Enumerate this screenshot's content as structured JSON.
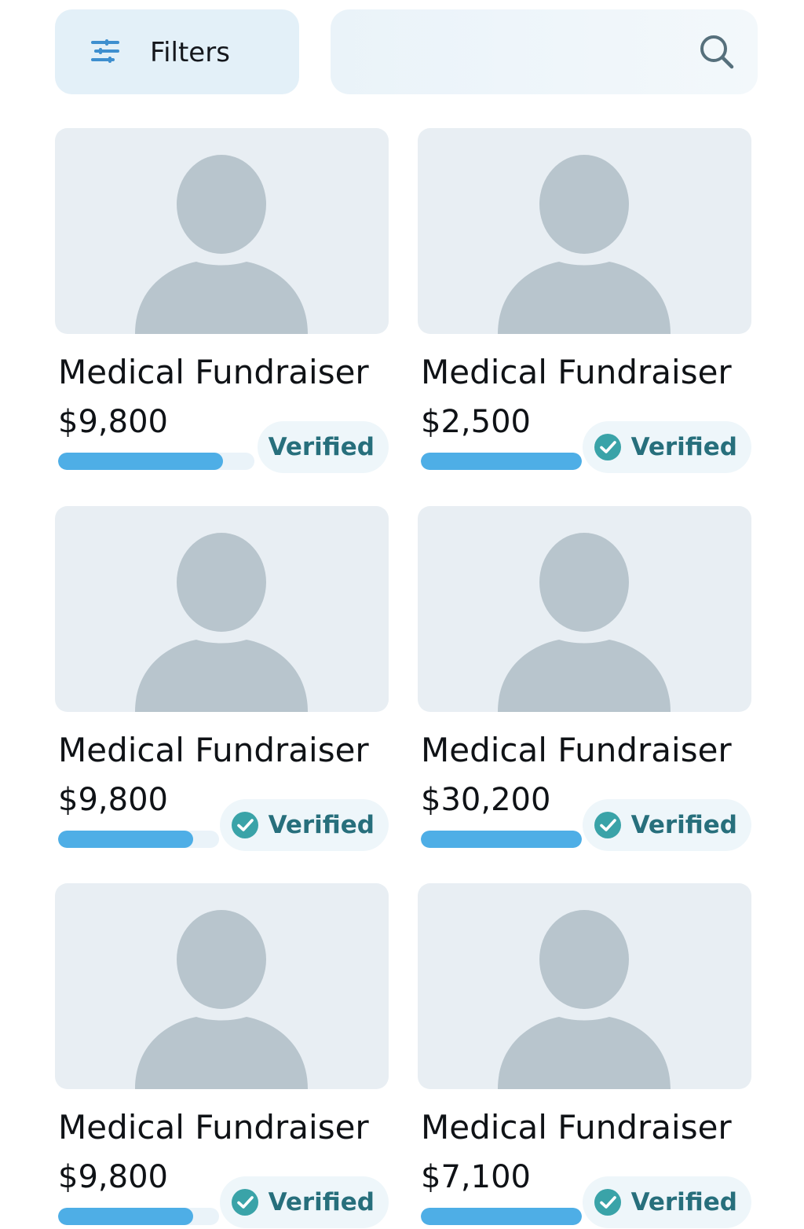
{
  "toolbar": {
    "filters_label": "Filters",
    "search_placeholder": "",
    "search_value": ""
  },
  "colors": {
    "progress_fill": "#4eaee6",
    "progress_track": "#eaf3f9",
    "badge_text": "#276f7c",
    "badge_check": "#3aa3a8",
    "avatar": "#b8c5cd"
  },
  "cards": [
    {
      "title": "Medical Fundraiser",
      "amount": "$9,800",
      "progress": 0.84,
      "badge": "Verified",
      "check": false
    },
    {
      "title": "Medical Fundraiser",
      "amount": "$2,500",
      "progress": 1.0,
      "badge": "Verified",
      "check": true
    },
    {
      "title": "Medical Fundraiser",
      "amount": "$9,800",
      "progress": 0.84,
      "badge": "Verified",
      "check": true
    },
    {
      "title": "Medical Fundraiser",
      "amount": "$30,200",
      "progress": 1.0,
      "badge": "Verified",
      "check": true
    },
    {
      "title": "Medical Fundraiser",
      "amount": "$9,800",
      "progress": 0.84,
      "badge": "Verified",
      "check": true
    },
    {
      "title": "Medical Fundraiser",
      "amount": "$7,100",
      "progress": 1.0,
      "badge": "Verified",
      "check": true
    }
  ]
}
